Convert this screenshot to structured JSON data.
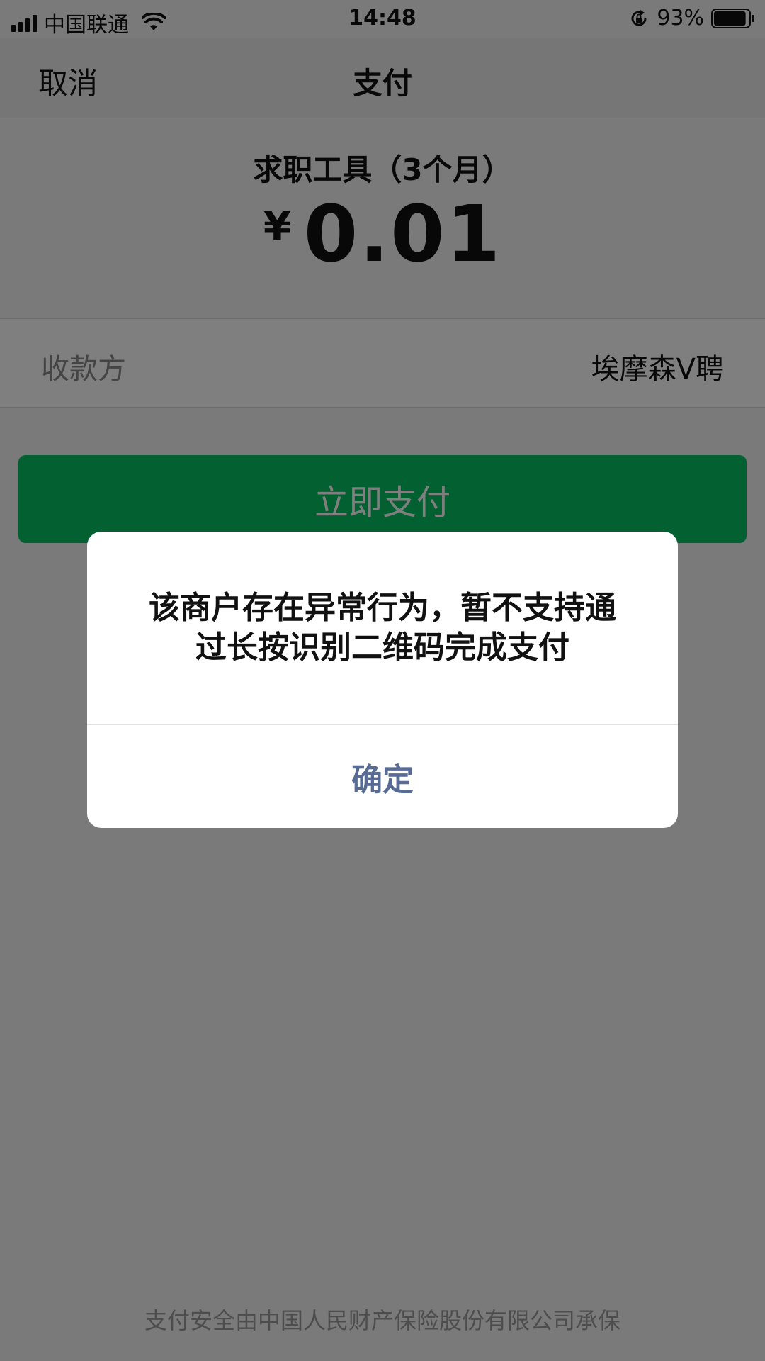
{
  "status_bar": {
    "carrier": "中国联通",
    "time": "14:48",
    "battery": "93%",
    "battery_level": 0.93
  },
  "nav": {
    "cancel": "取消",
    "title": "支付"
  },
  "product": {
    "name": "求职工具（3个月）",
    "currency_symbol": "¥",
    "amount": "0.01"
  },
  "payee": {
    "label": "收款方",
    "value": "埃摩森V聘"
  },
  "pay_button": {
    "label": "立即支付"
  },
  "dialog": {
    "line1": "该商户存在异常行为，暂不支持通",
    "line2": "过长按识别二维码完成支付",
    "confirm": "确定"
  },
  "footer": {
    "text": "支付安全由中国人民财产保险股份有限公司承保"
  },
  "colors": {
    "brand_green": "#07c160",
    "link_blue": "#576b95"
  },
  "icons": [
    "signal-icon",
    "wifi-icon",
    "rotation-lock-icon",
    "battery-icon"
  ]
}
